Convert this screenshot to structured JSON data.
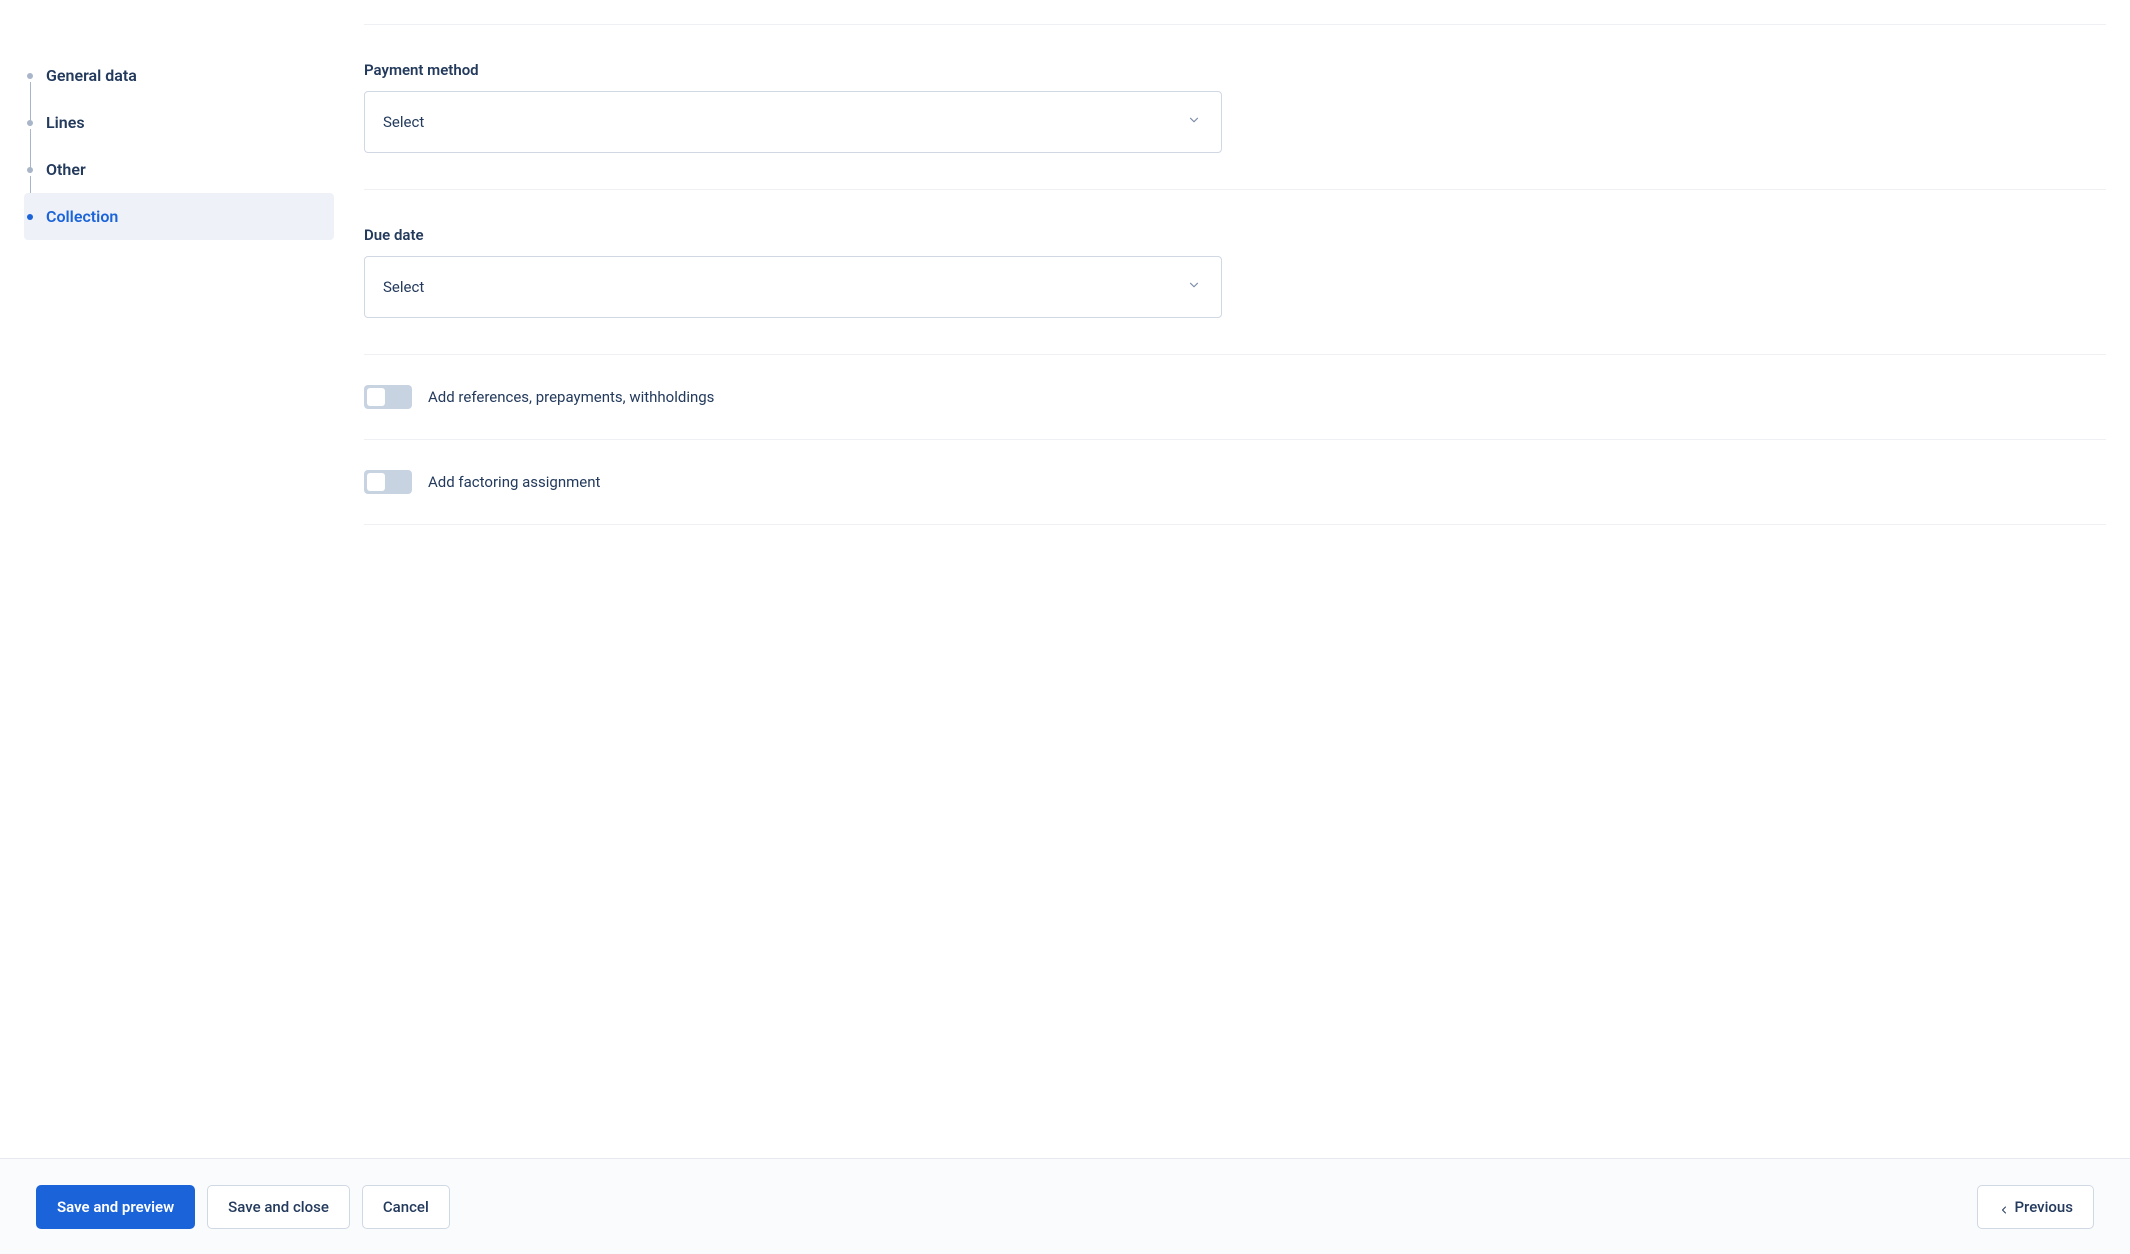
{
  "sidebar": {
    "items": [
      {
        "label": "General data",
        "active": false
      },
      {
        "label": "Lines",
        "active": false
      },
      {
        "label": "Other",
        "active": false
      },
      {
        "label": "Collection",
        "active": true
      }
    ]
  },
  "form": {
    "payment_method": {
      "label": "Payment method",
      "value": "Select"
    },
    "due_date": {
      "label": "Due date",
      "value": "Select"
    },
    "references_toggle": {
      "label": "Add references, prepayments, withholdings",
      "checked": false
    },
    "factoring_toggle": {
      "label": "Add factoring assignment",
      "checked": false
    }
  },
  "footer": {
    "save_preview": "Save and preview",
    "save_close": "Save and close",
    "cancel": "Cancel",
    "previous": "Previous"
  }
}
